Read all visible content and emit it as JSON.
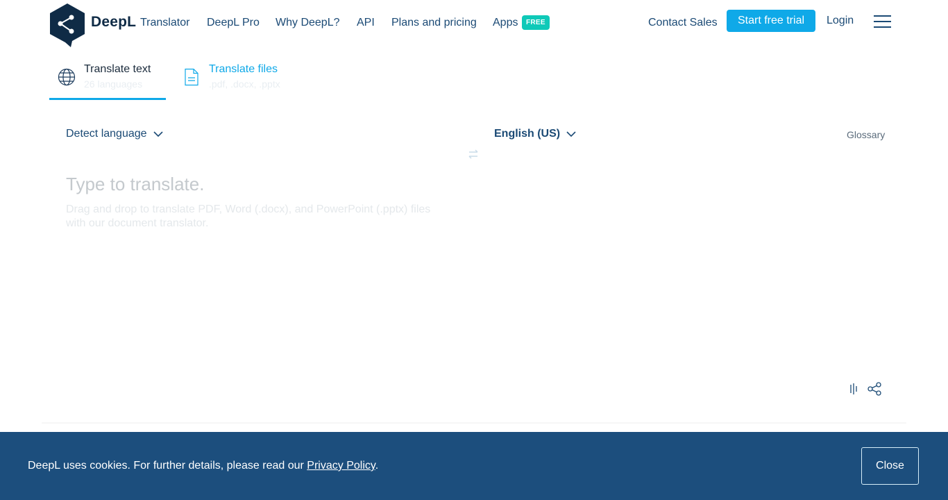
{
  "header": {
    "brand": "DeepL",
    "brand_sub": "Translator",
    "nav": {
      "deepl_pro": "DeepL Pro",
      "why_deepl": "Why DeepL?",
      "api": "API",
      "plans": "Plans and pricing",
      "apps": "Apps",
      "apps_badge": "FREE",
      "contact_sales": "Contact Sales",
      "start_trial": "Start free trial",
      "login": "Login"
    }
  },
  "modes": {
    "text_title": "Translate text",
    "text_sub": "26 languages",
    "files_title": "Translate files",
    "files_sub": ".pdf, .docx, .pptx"
  },
  "translator": {
    "source_lang": "Detect language",
    "target_lang": "English (US)",
    "glossary": "Glossary",
    "placeholder": "Type to translate.",
    "drag_hint": "Drag and drop to translate PDF, Word (.docx), and PowerPoint (.pptx) files with our document translator."
  },
  "cookie": {
    "text": "DeepL uses cookies. For further details, please read our",
    "link": "Privacy Policy",
    "suffix": ".",
    "close": "Close"
  },
  "colors": {
    "accent": "#0fa9e8",
    "navy": "#1b4a75",
    "badge": "#0fc9b8",
    "banner": "#1c4e7d"
  },
  "icons": [
    "deepl-logo",
    "globe-icon",
    "document-icon",
    "chevron-down-icon",
    "swap-icon",
    "feedback-icon",
    "share-icon",
    "hamburger-menu-icon"
  ]
}
